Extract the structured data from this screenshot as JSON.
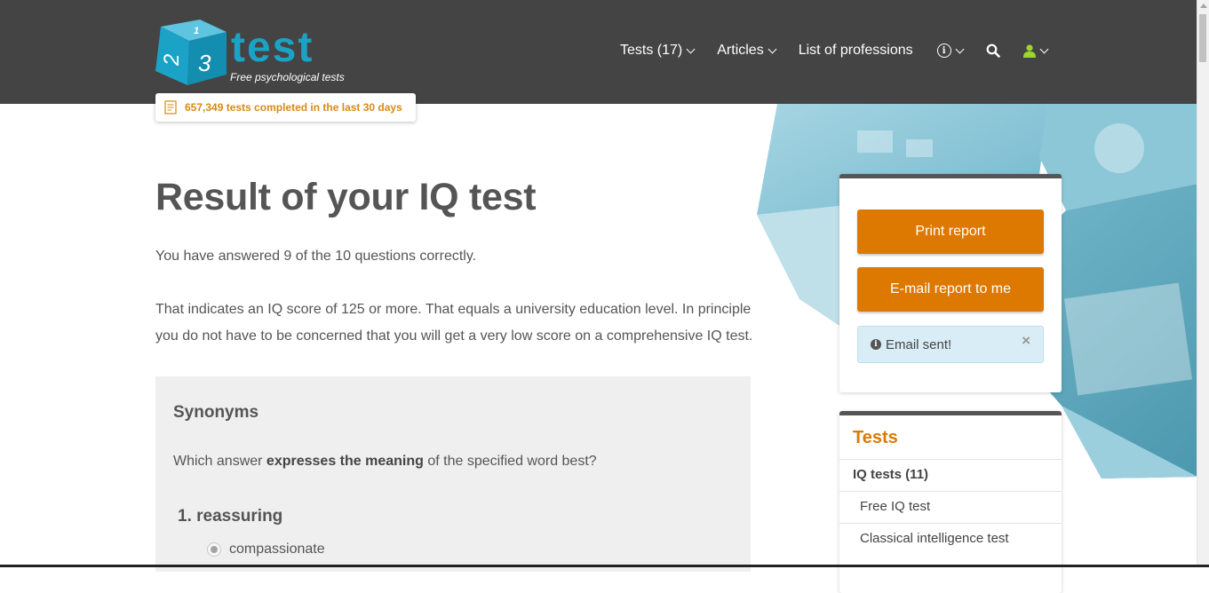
{
  "header": {
    "logo_word": "test",
    "logo_cube_digits": [
      "1",
      "2",
      "3"
    ],
    "tagline": "Free psychological tests",
    "counter_text": "657,349 tests completed in the last 30 days",
    "nav": [
      {
        "label": "Tests (17)",
        "has_dropdown": true
      },
      {
        "label": "Articles",
        "has_dropdown": true
      },
      {
        "label": "List of professions",
        "has_dropdown": false
      }
    ],
    "icons": [
      "info-icon",
      "search-icon",
      "user-icon"
    ],
    "user_icon_color": "#9bd62a"
  },
  "main": {
    "title": "Result of your IQ test",
    "paragraph1": "You have answered 9 of the 10 questions correctly.",
    "paragraph2": "That indicates an IQ score of 125 or more. That equals a university education level. In principle you do not have to be concerned that you will get a very low score on a comprehensive IQ test.",
    "quiz": {
      "section_title": "Synonyms",
      "instruction_pre": "Which answer ",
      "instruction_bold": "expresses the meaning",
      "instruction_post": " of the specified word best?",
      "question": "1. reassuring",
      "options": [
        {
          "label": "compassionate",
          "selected": true
        }
      ]
    }
  },
  "sidebar": {
    "print_button": "Print report",
    "email_button": "E-mail report to me",
    "alert_text": "Email sent!",
    "alert_close": "×",
    "tests_title": "Tests",
    "tests_items": [
      {
        "label": "IQ tests (11)",
        "type": "group"
      },
      {
        "label": "Free IQ test",
        "type": "sub"
      },
      {
        "label": "Classical intelligence test",
        "type": "sub"
      }
    ]
  },
  "colors": {
    "header_bg": "#444444",
    "accent_orange": "#dd7900",
    "logo_blue": "#1aa3c6",
    "alert_bg": "#d9edf7",
    "quiz_bg": "#efefef"
  }
}
